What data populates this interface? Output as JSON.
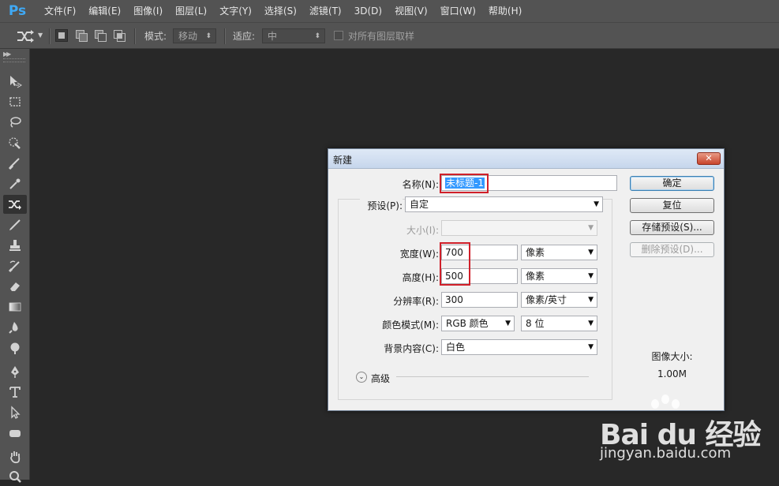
{
  "app": {
    "logo": "Ps",
    "menu": [
      "文件(F)",
      "编辑(E)",
      "图像(I)",
      "图层(L)",
      "文字(Y)",
      "选择(S)",
      "滤镜(T)",
      "3D(D)",
      "视图(V)",
      "窗口(W)",
      "帮助(H)"
    ]
  },
  "options_bar": {
    "mode_label": "模式:",
    "mode_value": "移动",
    "adapt_label": "适应:",
    "adapt_value": "中",
    "sample_all_layers_label": "对所有图层取样"
  },
  "dialog": {
    "title": "新建",
    "close_label": "✕",
    "name_label": "名称(N):",
    "name_value": "未标题-1",
    "preset_label": "预设(P):",
    "preset_value": "自定",
    "size_label": "大小(I):",
    "size_value": "",
    "width_label": "宽度(W):",
    "width_value": "700",
    "width_unit": "像素",
    "height_label": "高度(H):",
    "height_value": "500",
    "height_unit": "像素",
    "resolution_label": "分辨率(R):",
    "resolution_value": "300",
    "resolution_unit": "像素/英寸",
    "color_mode_label": "颜色模式(M):",
    "color_mode_value": "RGB 颜色",
    "bit_depth_value": "8 位",
    "background_label": "背景内容(C):",
    "background_value": "白色",
    "advanced_label": "高级",
    "image_size_label": "图像大小:",
    "image_size_value": "1.00M",
    "buttons": {
      "ok": "确定",
      "reset": "复位",
      "save_preset": "存储预设(S)...",
      "delete_preset": "删除预设(D)..."
    }
  },
  "watermark": {
    "main": "Bai du 经验",
    "sub": "jingyan.baidu.com"
  },
  "colors": {
    "ps_blue": "#3fa9f5",
    "highlight_red": "#d0202a",
    "selection_blue": "#3399ff"
  }
}
